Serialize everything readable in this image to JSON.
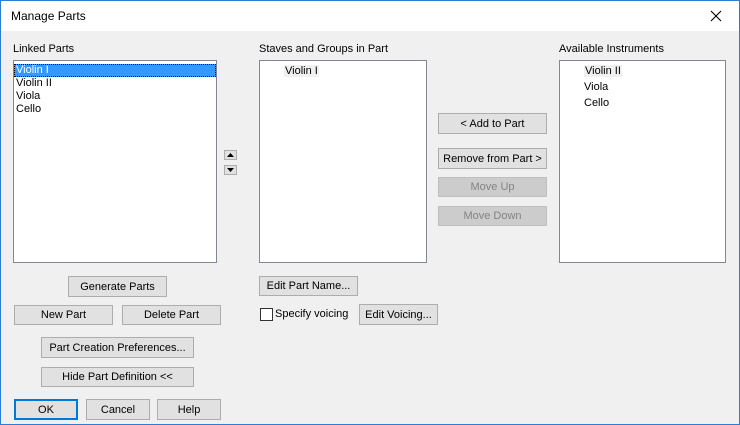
{
  "window": {
    "title": "Manage Parts"
  },
  "linked_parts": {
    "label": "Linked Parts",
    "items": [
      "Violin I",
      "Violin II",
      "Viola",
      "Cello"
    ],
    "selected_index": 0
  },
  "staves": {
    "label": "Staves and Groups in Part",
    "items": [
      "Violin I"
    ]
  },
  "available": {
    "label": "Available Instruments",
    "items": [
      "Violin II",
      "Viola",
      "Cello"
    ]
  },
  "buttons": {
    "add_to_part": "< Add to Part",
    "remove_from_part": "Remove from Part >",
    "move_up": "Move Up",
    "move_down": "Move Down",
    "generate_parts": "Generate Parts",
    "new_part": "New Part",
    "delete_part": "Delete Part",
    "part_creation_prefs": "Part Creation Preferences...",
    "hide_part_definition": "Hide Part Definition <<",
    "ok": "OK",
    "cancel": "Cancel",
    "help": "Help",
    "edit_part_name": "Edit Part Name...",
    "edit_voicing": "Edit Voicing..."
  },
  "specify_voicing": {
    "label": "Specify voicing",
    "checked": false
  }
}
